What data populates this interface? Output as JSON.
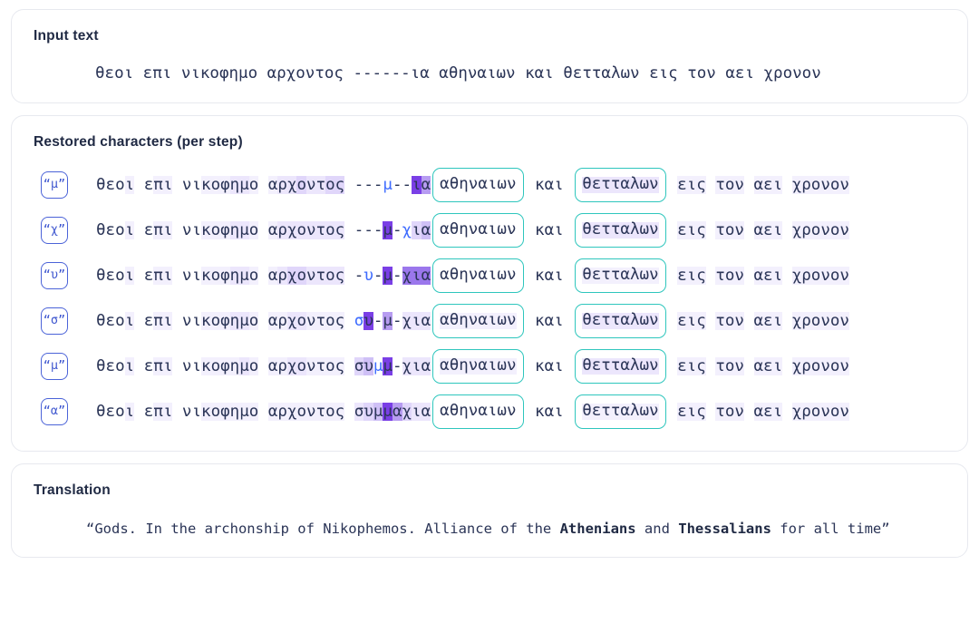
{
  "input": {
    "title": "Input text",
    "text": "θεοι επι νικοφημο αρχοντος ------ια αθηναιων και θετταλων εις τον αει χρονον"
  },
  "restored": {
    "title": "Restored characters (per step)",
    "boxed_words": [
      "αθηναιων",
      "θετταλων"
    ],
    "prefix": "θεοι επι νικοφημο αρχοντος ",
    "mid": " και ",
    "suffix": " εις τον αει χρονον",
    "steps": [
      {
        "chip": "“μ”",
        "gap": "---μ--ια",
        "gap_chars": [
          "-",
          "-",
          "-",
          "μ",
          "-",
          "-",
          "ι",
          "α"
        ],
        "gap_shades": [
          0,
          0,
          0,
          0,
          0,
          0,
          8,
          5
        ],
        "gap_new_index": 3
      },
      {
        "chip": "“χ”",
        "gap": "---μ-χια",
        "gap_chars": [
          "-",
          "-",
          "-",
          "μ",
          "-",
          "χ",
          "ι",
          "α"
        ],
        "gap_shades": [
          0,
          0,
          0,
          8,
          0,
          0,
          3,
          4
        ],
        "gap_new_index": 5
      },
      {
        "chip": "“υ”",
        "gap": "-υ-μ-χια",
        "gap_chars": [
          "-",
          "υ",
          "-",
          "μ",
          "-",
          "χ",
          "ι",
          "α"
        ],
        "gap_shades": [
          0,
          0,
          0,
          8,
          0,
          6,
          6,
          6
        ],
        "gap_new_index": 1
      },
      {
        "chip": "“σ”",
        "gap": "συ-μ-χια",
        "gap_chars": [
          "σ",
          "υ",
          "-",
          "μ",
          "-",
          "χ",
          "ι",
          "α"
        ],
        "gap_shades": [
          0,
          8,
          0,
          5,
          0,
          2,
          2,
          2
        ],
        "gap_new_index": 0
      },
      {
        "chip": "“μ”",
        "gap": "συμμ-χια",
        "gap_chars": [
          "σ",
          "υ",
          "μ",
          "μ",
          "-",
          "χ",
          "ι",
          "α"
        ],
        "gap_shades": [
          3,
          4,
          0,
          8,
          0,
          2,
          2,
          2
        ],
        "gap_new_index": 2
      },
      {
        "chip": "“α”",
        "gap": "συμμαχια",
        "gap_chars": [
          "σ",
          "υ",
          "μ",
          "μ",
          "α",
          "χ",
          "ι",
          "α"
        ],
        "gap_shades": [
          2,
          3,
          4,
          8,
          5,
          3,
          2,
          2
        ],
        "gap_new_index": -1
      }
    ],
    "prefix_shades": [
      [
        0,
        0,
        0,
        1,
        0,
        0,
        1,
        1,
        0,
        0,
        0,
        1,
        1,
        1,
        2,
        2,
        1,
        0,
        1,
        2,
        2,
        3,
        2,
        2,
        3,
        3,
        0
      ],
      [
        0,
        0,
        0,
        1,
        0,
        0,
        1,
        1,
        0,
        0,
        0,
        1,
        1,
        1,
        2,
        2,
        1,
        0,
        1,
        2,
        2,
        2,
        2,
        2,
        2,
        2,
        0
      ],
      [
        0,
        0,
        0,
        1,
        0,
        0,
        1,
        1,
        0,
        0,
        0,
        1,
        1,
        1,
        2,
        2,
        1,
        0,
        1,
        2,
        3,
        3,
        2,
        2,
        2,
        2,
        0
      ],
      [
        0,
        0,
        0,
        1,
        0,
        0,
        1,
        1,
        0,
        0,
        0,
        1,
        1,
        1,
        2,
        2,
        1,
        0,
        1,
        1,
        2,
        2,
        1,
        1,
        1,
        1,
        0
      ],
      [
        0,
        0,
        0,
        1,
        0,
        0,
        1,
        1,
        0,
        0,
        0,
        1,
        1,
        1,
        1,
        2,
        1,
        0,
        1,
        1,
        2,
        2,
        1,
        1,
        1,
        1,
        0
      ],
      [
        0,
        0,
        0,
        1,
        0,
        0,
        1,
        1,
        0,
        0,
        0,
        1,
        1,
        1,
        1,
        1,
        1,
        0,
        1,
        1,
        1,
        1,
        1,
        1,
        1,
        1,
        0
      ]
    ],
    "boxed1_shades": [
      [
        0,
        0,
        0,
        0,
        0,
        0,
        0,
        0
      ],
      [
        0,
        0,
        0,
        0,
        0,
        0,
        0,
        0
      ],
      [
        0,
        0,
        0,
        0,
        0,
        0,
        0,
        0
      ],
      [
        1,
        1,
        1,
        1,
        1,
        1,
        1,
        1
      ],
      [
        1,
        1,
        1,
        1,
        1,
        1,
        1,
        1
      ],
      [
        0,
        0,
        0,
        0,
        0,
        0,
        0,
        0
      ]
    ],
    "boxed2_shades": [
      [
        2,
        2,
        2,
        2,
        2,
        2,
        2,
        2
      ],
      [
        2,
        2,
        2,
        2,
        2,
        2,
        2,
        2
      ],
      [
        1,
        1,
        1,
        1,
        1,
        1,
        1,
        1
      ],
      [
        2,
        2,
        2,
        2,
        2,
        2,
        2,
        2
      ],
      [
        2,
        2,
        2,
        2,
        2,
        2,
        2,
        2
      ],
      [
        1,
        1,
        1,
        1,
        1,
        1,
        1,
        1
      ]
    ],
    "suffix_shades": [
      [
        0,
        1,
        1,
        1,
        0,
        1,
        1,
        1,
        0,
        1,
        1,
        1,
        0,
        1,
        1,
        1,
        1,
        1,
        1
      ],
      [
        0,
        1,
        1,
        1,
        0,
        1,
        1,
        1,
        0,
        1,
        1,
        1,
        0,
        1,
        1,
        1,
        1,
        1,
        1
      ],
      [
        0,
        1,
        1,
        1,
        0,
        1,
        1,
        1,
        0,
        1,
        1,
        1,
        0,
        1,
        1,
        1,
        1,
        1,
        1
      ],
      [
        0,
        1,
        1,
        1,
        0,
        1,
        1,
        1,
        0,
        1,
        1,
        1,
        0,
        1,
        1,
        1,
        1,
        1,
        1
      ],
      [
        0,
        1,
        1,
        1,
        0,
        1,
        1,
        1,
        0,
        1,
        1,
        1,
        0,
        1,
        1,
        1,
        1,
        1,
        1
      ],
      [
        0,
        1,
        1,
        1,
        0,
        1,
        1,
        1,
        0,
        1,
        1,
        1,
        0,
        1,
        1,
        1,
        1,
        1,
        1
      ]
    ]
  },
  "translation": {
    "title": "Translation",
    "text_plain": "“Gods. In the archonship of Nikophemos. Alliance of the Athenians and Thessalians for all time”",
    "parts": [
      {
        "t": "“Gods. In the archonship of Nikophemos. Alliance of the ",
        "b": false
      },
      {
        "t": "Athenians",
        "b": true
      },
      {
        "t": " and ",
        "b": false
      },
      {
        "t": "Thessalians",
        "b": true
      },
      {
        "t": " for all time”",
        "b": false
      }
    ]
  },
  "colors": {
    "accent_blue": "#3d6bff",
    "chip_border": "#4b63d8",
    "box_teal": "#2ec6bd",
    "text": "#2b3557",
    "title": "#202a44",
    "card_border": "#e7e9ef",
    "highlight_strong": "#7a3fe6"
  }
}
